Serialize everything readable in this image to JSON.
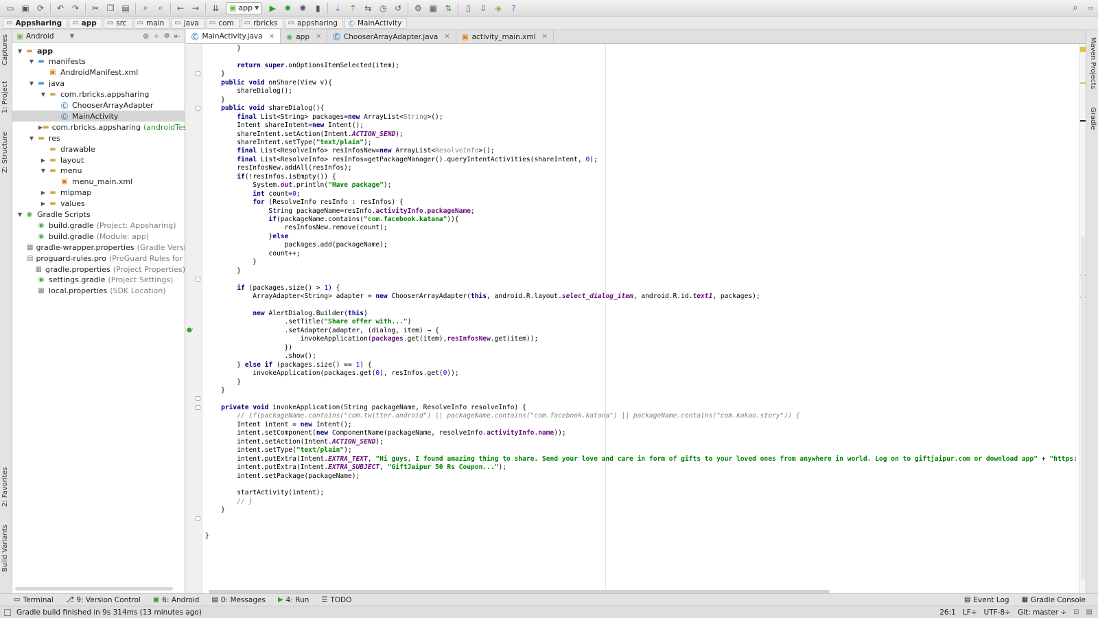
{
  "toolbar": {
    "run_config": "app",
    "icons": [
      "open-icon",
      "save-icon",
      "sync-icon",
      "undo-icon",
      "redo-icon",
      "cut-icon",
      "copy-icon",
      "paste-icon",
      "find-icon",
      "replace-icon",
      "back-icon",
      "forward-icon",
      "make-project-icon"
    ],
    "icons2": [
      "run-icon",
      "debug-icon",
      "attach-debugger-icon",
      "coverage-icon",
      "vcs-update-icon",
      "vcs-commit-icon",
      "vcs-compare-icon",
      "vcs-history-icon",
      "vcs-revert-icon",
      "sdk-settings-icon",
      "project-structure-icon",
      "gradle-sync-icon",
      "avd-manager-icon",
      "sdk-manager-icon",
      "android-monitor-icon",
      "help-icon"
    ],
    "search_icon": "search-icon"
  },
  "breadcrumbs": [
    "Appsharing",
    "app",
    "src",
    "main",
    "java",
    "com",
    "rbricks",
    "appsharing",
    "MainActivity"
  ],
  "project_panel": {
    "view": "Android",
    "tree": [
      {
        "label": "app",
        "hint": "",
        "depth": 0,
        "arrow": "down",
        "icon": "folder"
      },
      {
        "label": "manifests",
        "hint": "",
        "depth": 1,
        "arrow": "down",
        "icon": "folder"
      },
      {
        "label": "AndroidManifest.xml",
        "hint": "",
        "depth": 2,
        "arrow": "",
        "icon": "xml"
      },
      {
        "label": "java",
        "hint": "",
        "depth": 1,
        "arrow": "down",
        "icon": "folder"
      },
      {
        "label": "com.rbricks.appsharing",
        "hint": "",
        "depth": 2,
        "arrow": "down",
        "icon": "folder"
      },
      {
        "label": "ChooserArrayAdapter",
        "hint": "",
        "depth": 3,
        "arrow": "",
        "icon": "class"
      },
      {
        "label": "MainActivity",
        "hint": "",
        "depth": 3,
        "arrow": "",
        "icon": "class",
        "selected": true
      },
      {
        "label": "com.rbricks.appsharing",
        "hint": "(androidTest)",
        "depth": 2,
        "arrow": "right",
        "icon": "folder"
      },
      {
        "label": "res",
        "hint": "",
        "depth": 1,
        "arrow": "down",
        "icon": "folder"
      },
      {
        "label": "drawable",
        "hint": "",
        "depth": 2,
        "arrow": "",
        "icon": "folder"
      },
      {
        "label": "layout",
        "hint": "",
        "depth": 2,
        "arrow": "right",
        "icon": "folder"
      },
      {
        "label": "menu",
        "hint": "",
        "depth": 2,
        "arrow": "down",
        "icon": "folder"
      },
      {
        "label": "menu_main.xml",
        "hint": "",
        "depth": 3,
        "arrow": "",
        "icon": "xml"
      },
      {
        "label": "mipmap",
        "hint": "",
        "depth": 2,
        "arrow": "right",
        "icon": "folder"
      },
      {
        "label": "values",
        "hint": "",
        "depth": 2,
        "arrow": "right",
        "icon": "folder"
      },
      {
        "label": "Gradle Scripts",
        "hint": "",
        "depth": 0,
        "arrow": "down",
        "icon": "gradle"
      },
      {
        "label": "build.gradle",
        "hint": "(Project: Appsharing)",
        "depth": 1,
        "arrow": "",
        "icon": "gradle"
      },
      {
        "label": "build.gradle",
        "hint": "(Module: app)",
        "depth": 1,
        "arrow": "",
        "icon": "gradle"
      },
      {
        "label": "gradle-wrapper.properties",
        "hint": "(Gradle Versio",
        "depth": 1,
        "arrow": "",
        "icon": "props"
      },
      {
        "label": "proguard-rules.pro",
        "hint": "(ProGuard Rules for a",
        "depth": 1,
        "arrow": "",
        "icon": "file"
      },
      {
        "label": "gradle.properties",
        "hint": "(Project Properties)",
        "depth": 1,
        "arrow": "",
        "icon": "props"
      },
      {
        "label": "settings.gradle",
        "hint": "(Project Settings)",
        "depth": 1,
        "arrow": "",
        "icon": "gradle"
      },
      {
        "label": "local.properties",
        "hint": "(SDK Location)",
        "depth": 1,
        "arrow": "",
        "icon": "props"
      }
    ]
  },
  "side_tabs": {
    "left": [
      "Captures",
      "1: Project",
      "Z: Structure",
      "2: Favorites",
      "Build Variants"
    ],
    "right": [
      "Maven Projects",
      "Gradle"
    ]
  },
  "editor_tabs": [
    {
      "label": "MainActivity.java",
      "icon": "class",
      "active": true
    },
    {
      "label": "app",
      "icon": "gradle",
      "active": false
    },
    {
      "label": "ChooserArrayAdapter.java",
      "icon": "class",
      "active": false
    },
    {
      "label": "activity_main.xml",
      "icon": "xml",
      "active": false
    }
  ],
  "code": [
    "        }",
    "",
    "        <k>return super</k>.onOptionsItemSelected(item);",
    "    }",
    "    <k>public void</k> onShare(View v){",
    "        shareDialog();",
    "    }",
    "    <k>public void</k> shareDialog(){",
    "        <k>final</k> List&lt;String&gt; packages=<k>new</k> ArrayList&lt;<g>String</g>&gt;();",
    "        Intent shareIntent=<k>new</k> Intent();",
    "        shareIntent.setAction(Intent.<f>ACTION_SEND</f>);",
    "        shareIntent.setType(<s>\"text/plain\"</s>);",
    "        <k>final</k> List&lt;ResolveInfo&gt; resInfosNew=<k>new</k> ArrayList&lt;<g>ResolveInfo</g>&gt;();",
    "        <k>final</k> List&lt;ResolveInfo&gt; resInfos=getPackageManager().queryIntentActivities(shareIntent, <n>0</n>);",
    "        resInfosNew.addAll(resInfos);",
    "        <k>if</k>(!resInfos.isEmpty()) {",
    "            System.<f>out</f>.println(<s>\"Have package\"</s>);",
    "            <k>int</k> count=<n>0</n>;",
    "            <k>for</k> (ResolveInfo resInfo : resInfos) {",
    "                String packageName=resInfo.<m>activityInfo</m>.<m>packageName</m>;",
    "                <k>if</k>(packageName.contains(<s>\"com.facebook.katana\"</s>)){",
    "                    resInfosNew.remove(count);",
    "                }<k>else</k>",
    "                    packages.add(packageName);",
    "                count++;",
    "            }",
    "        }",
    "",
    "        <k>if</k> (packages.size() &gt; <n>1</n>) {",
    "            ArrayAdapter&lt;String&gt; adapter = <k>new</k> ChooserArrayAdapter(<k>this</k>, android.R.layout.<f>select_dialog_item</f>, android.R.id.<f>text1</f>, packages);",
    "",
    "            <k>new</k> AlertDialog.Builder(<k>this</k>)",
    "                    .setTitle(<s>\"Share offer with...\"</s>)",
    "                    .setAdapter(adapter, (dialog, item) → {",
    "                        invokeApplication(<m>packages</m>.get(item),<m>resInfosNew</m>.get(item));",
    "                    })",
    "                    .show();",
    "        } <k>else if</k> (packages.size() == <n>1</n>) {",
    "            invokeApplication(packages.get(<n>0</n>), resInfos.get(<n>0</n>));",
    "        }",
    "    }",
    "",
    "    <k>private void</k> invokeApplication(String packageName, ResolveInfo resolveInfo) {",
    "        <c>// if(packageName.contains(\"com.twitter.android\") || packageName.contains(\"com.facebook.katana\") || packageName.contains(\"com.kakao.story\")) {</c>",
    "        Intent intent = <k>new</k> Intent();",
    "        intent.setComponent(<k>new</k> ComponentName(packageName, resolveInfo.<m>activityInfo</m>.<m>name</m>));",
    "        intent.setAction(Intent.<f>ACTION_SEND</f>);",
    "        intent.setType(<s>\"text/plain\"</s>);",
    "        intent.putExtra(Intent.<f>EXTRA_TEXT</f>, <s>\"Hi guys, I found amazing thing to share. Send your love and care in form of gifts to your loved ones from anywhere in world. Log on to giftjaipur.com or download app\"</s> + <s>\"https:</s>",
    "        intent.putExtra(Intent.<f>EXTRA_SUBJECT</f>, <s>\"GiftJaipur 50 Rs Coupon...\"</s>);",
    "        intent.setPackage(packageName);",
    "",
    "        startActivity(intent);",
    "        <c>// }</c>",
    "    }",
    "",
    "",
    "}"
  ],
  "tool_windows": [
    {
      "label": "Terminal",
      "icon": "terminal-icon"
    },
    {
      "label": "9: Version Control",
      "icon": "version-control-icon"
    },
    {
      "label": "6: Android",
      "icon": "android-icon"
    },
    {
      "label": "0: Messages",
      "icon": "messages-icon"
    },
    {
      "label": "4: Run",
      "icon": "run-icon"
    },
    {
      "label": "TODO",
      "icon": "todo-icon"
    }
  ],
  "tool_windows_right": [
    {
      "label": "Event Log",
      "icon": "event-log-icon"
    },
    {
      "label": "Gradle Console",
      "icon": "gradle-console-icon"
    }
  ],
  "status": {
    "message": "Gradle build finished in 9s 314ms (13 minutes ago)",
    "position": "26:1",
    "line_sep": "LF÷",
    "encoding": "UTF-8÷",
    "vcs": "Git: master ÷"
  },
  "colors": {
    "keyword": "#000080",
    "string": "#008000",
    "number": "#0000ff",
    "field": "#660e7a",
    "comment": "#808080"
  }
}
